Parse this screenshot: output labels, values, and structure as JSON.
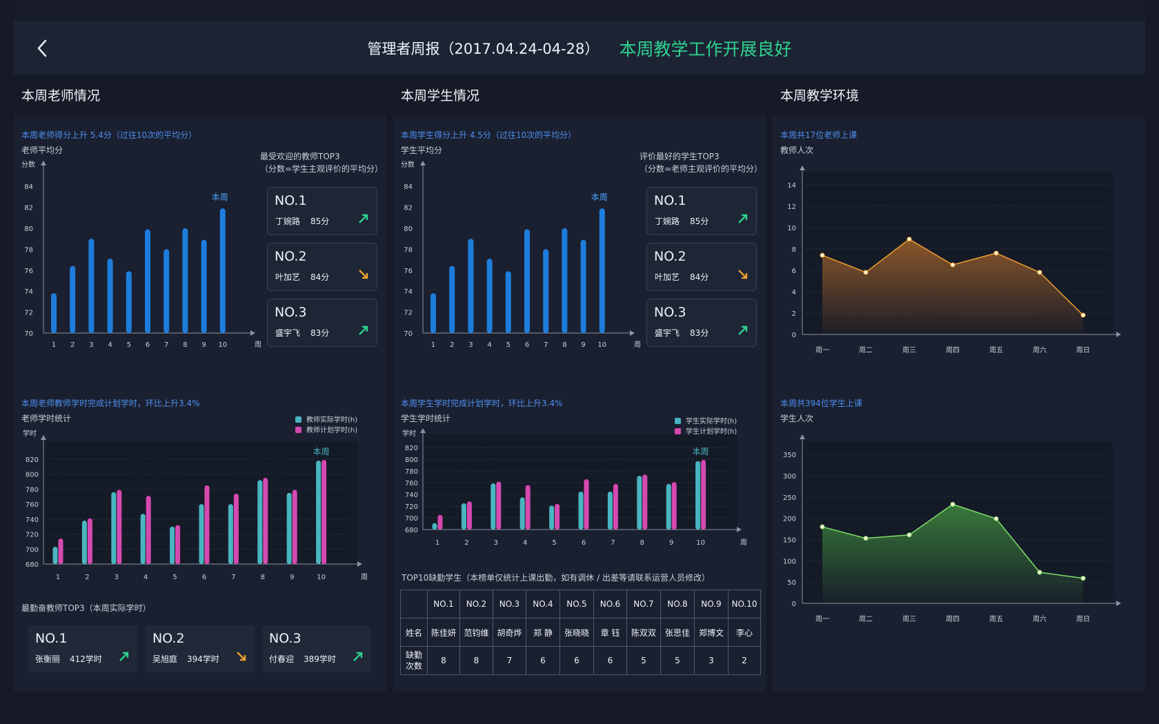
{
  "header": {
    "back_icon": "chevron-left-icon",
    "title": "管理者周报（2017.04.24-04-28）",
    "subtitle": "本周教学工作开展良好"
  },
  "colors": {
    "accent_green": "#2ed28f",
    "highlight_blue": "#4e8ff0",
    "bar_blue": "#1e7ddc",
    "teal": "#49b5c0",
    "magenta": "#d649b0",
    "orange": "#f0a030",
    "green_line": "#7ee06a",
    "arrow_up": "#2ed28f",
    "arrow_down": "#f0a030"
  },
  "teacher": {
    "section_title": "本周老师情况",
    "score_headline": "本周老师得分上升 5.4分（过往10次的平均分）",
    "score_label": "老师平均分",
    "top_title_1": "最受欢迎的教师TOP3",
    "top_title_2": "（分数=学生主观评价的平均分）",
    "top3": [
      {
        "no": "NO.1",
        "name": "丁婉路",
        "score": "85分",
        "trend": "up"
      },
      {
        "no": "NO.2",
        "name": "叶加艺",
        "score": "84分",
        "trend": "down"
      },
      {
        "no": "NO.3",
        "name": "盛宇飞",
        "score": "83分",
        "trend": "up"
      }
    ],
    "hours_headline": "本周老师教师学时完成计划学时，环比上升3.4%",
    "hours_label": "老师学时统计",
    "diligent_title": "最勤奋教师TOP3（本周实际学时）",
    "diligent": [
      {
        "no": "NO.1",
        "name": "张衡丽",
        "hours": "412学时",
        "trend": "up"
      },
      {
        "no": "NO.2",
        "name": "吴旭庭",
        "hours": "394学时",
        "trend": "down"
      },
      {
        "no": "NO.3",
        "name": "付春迎",
        "hours": "389学时",
        "trend": "up"
      }
    ]
  },
  "student": {
    "section_title": "本周学生情况",
    "score_headline": "本周学生得分上升 4.5分（过往10次的平均分）",
    "score_label": "学生平均分",
    "top_title_1": "评价最好的学生TOP3",
    "top_title_2": "（分数=老师主观评价的平均分）",
    "top3": [
      {
        "no": "NO.1",
        "name": "丁婉路",
        "score": "85分",
        "trend": "up"
      },
      {
        "no": "NO.2",
        "name": "叶加艺",
        "score": "84分",
        "trend": "down"
      },
      {
        "no": "NO.3",
        "name": "盛宇飞",
        "score": "83分",
        "trend": "up"
      }
    ],
    "hours_headline": "本周学生学时完成计划学时，环比上升3.4%",
    "hours_label": "学生学时统计",
    "absence_title": "TOP10缺勤学生（本榜单仅统计上课出勤，如有调休 / 出差等请联系运营人员修改）",
    "absence_table": {
      "ranks": [
        "NO.1",
        "NO.2",
        "NO.3",
        "NO.4",
        "NO.5",
        "NO.6",
        "NO.7",
        "NO.8",
        "NO.9",
        "NO.10"
      ],
      "name_header": "姓名",
      "names": [
        "陈佳妍",
        "范钧维",
        "胡奇烨",
        "郑 静",
        "张晓晓",
        "章 钰",
        "陈双双",
        "张思佳",
        "郑博文",
        "李心"
      ],
      "count_header_1": "缺勤",
      "count_header_2": "次数",
      "counts": [
        "8",
        "8",
        "7",
        "6",
        "6",
        "6",
        "5",
        "5",
        "3",
        "2"
      ]
    }
  },
  "environment": {
    "section_title": "本周教学环境",
    "teacher_headline": "本周共17位老师上课",
    "teacher_label": "教师人次",
    "student_headline": "本周共394位学生上课",
    "student_label": "学生人次"
  },
  "chart_data": [
    {
      "id": "teacher-score",
      "type": "bar",
      "categories": [
        "1",
        "2",
        "3",
        "4",
        "5",
        "6",
        "7",
        "8",
        "9",
        "10"
      ],
      "values": [
        73.8,
        76.4,
        79,
        77.1,
        75.9,
        79.9,
        78,
        80,
        78.9,
        81.9
      ],
      "ylabel": "分数",
      "xlabel": "周",
      "ylim": [
        70,
        85
      ],
      "yticks": [
        70,
        72,
        74,
        76,
        78,
        80,
        82,
        84
      ],
      "annotation": "本周",
      "grid": false
    },
    {
      "id": "student-score",
      "type": "bar",
      "categories": [
        "1",
        "2",
        "3",
        "4",
        "5",
        "6",
        "7",
        "8",
        "9",
        "10"
      ],
      "values": [
        73.8,
        76.4,
        79,
        77.1,
        75.9,
        79.9,
        78,
        80,
        78.9,
        81.9
      ],
      "ylabel": "分数",
      "xlabel": "周",
      "ylim": [
        70,
        85
      ],
      "yticks": [
        70,
        72,
        74,
        76,
        78,
        80,
        82,
        84
      ],
      "annotation": "本周",
      "grid": false
    },
    {
      "id": "teacher-hours",
      "type": "bar",
      "categories": [
        "1",
        "2",
        "3",
        "4",
        "5",
        "6",
        "7",
        "8",
        "9",
        "10"
      ],
      "series": [
        {
          "name": "教师实际学时(h)",
          "values": [
            703,
            738,
            776,
            747,
            730,
            760,
            760,
            792,
            775,
            818
          ]
        },
        {
          "name": "教师计划学时(h)",
          "values": [
            714,
            741,
            779,
            771,
            732,
            785,
            774,
            795,
            779,
            819
          ]
        }
      ],
      "ylabel": "学时",
      "xlabel": "周",
      "ylim": [
        680,
        830
      ],
      "yticks": [
        680,
        700,
        720,
        740,
        760,
        780,
        800,
        820
      ],
      "annotation": "本周",
      "legend": "top-right",
      "grid": true
    },
    {
      "id": "student-hours",
      "type": "bar",
      "categories": [
        "1",
        "2",
        "3",
        "4",
        "5",
        "6",
        "7",
        "8",
        "9",
        "10"
      ],
      "series": [
        {
          "name": "学生实际学时(h)",
          "values": [
            691,
            725,
            759,
            735,
            721,
            745,
            745,
            772,
            758,
            797
          ]
        },
        {
          "name": "学生计划学时(h)",
          "values": [
            705,
            728,
            762,
            756,
            724,
            766,
            758,
            774,
            761,
            799
          ]
        }
      ],
      "ylabel": "学时",
      "xlabel": "周",
      "ylim": [
        680,
        825
      ],
      "yticks": [
        680,
        700,
        720,
        740,
        760,
        780,
        800,
        820
      ],
      "annotation": "本周",
      "legend": "top-right",
      "grid": true
    },
    {
      "id": "teacher-visits",
      "type": "area",
      "x": [
        "周一",
        "周二",
        "周三",
        "周四",
        "周五",
        "周六",
        "周日"
      ],
      "values": [
        7.4,
        5.8,
        8.9,
        6.5,
        7.6,
        5.8,
        1.8
      ],
      "ylim": [
        0,
        14.5
      ],
      "yticks": [
        0,
        2,
        4,
        6,
        8,
        10,
        12,
        14
      ],
      "grid": true
    },
    {
      "id": "student-visits",
      "type": "area",
      "x": [
        "周一",
        "周二",
        "周三",
        "周四",
        "周五",
        "周六",
        "周日"
      ],
      "values": [
        180,
        153,
        161,
        233,
        199,
        73,
        59
      ],
      "ylim": [
        0,
        365
      ],
      "yticks": [
        0,
        50,
        100,
        150,
        200,
        250,
        300,
        350
      ],
      "grid": true
    }
  ]
}
